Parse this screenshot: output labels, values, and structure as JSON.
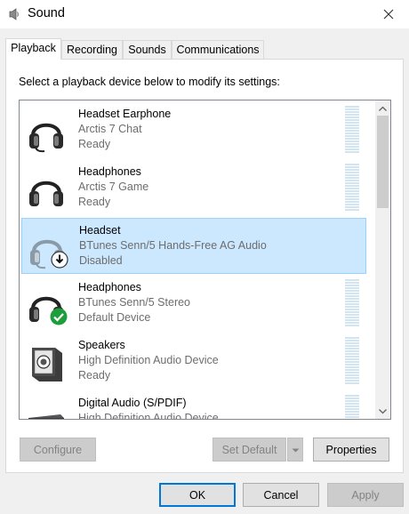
{
  "window": {
    "title": "Sound",
    "icon": "speaker-icon",
    "close_icon": "close-icon"
  },
  "tabs": [
    {
      "label": "Playback",
      "active": true
    },
    {
      "label": "Recording",
      "active": false
    },
    {
      "label": "Sounds",
      "active": false
    },
    {
      "label": "Communications",
      "active": false
    }
  ],
  "instruction": "Select a playback device below to modify its settings:",
  "devices": [
    {
      "name": "Headset Earphone",
      "description": "Arctis 7 Chat",
      "status": "Ready",
      "icon": "headset-mic-icon",
      "badge": null,
      "selected": false
    },
    {
      "name": "Headphones",
      "description": "Arctis 7 Game",
      "status": "Ready",
      "icon": "headphones-icon",
      "badge": null,
      "selected": false
    },
    {
      "name": "Headset",
      "description": "BTunes Senn/5 Hands-Free AG Audio",
      "status": "Disabled",
      "icon": "headset-icon",
      "badge": "disabled-down-arrow-icon",
      "selected": true
    },
    {
      "name": "Headphones",
      "description": "BTunes Senn/5 Stereo",
      "status": "Default Device",
      "icon": "headphones-icon",
      "badge": "default-checkmark-icon",
      "selected": false
    },
    {
      "name": "Speakers",
      "description": "High Definition Audio Device",
      "status": "Ready",
      "icon": "speaker-box-icon",
      "badge": null,
      "selected": false
    },
    {
      "name": "Digital Audio (S/PDIF)",
      "description": "High Definition Audio Device",
      "status": "",
      "icon": "digital-audio-icon",
      "badge": null,
      "selected": false
    }
  ],
  "buttons": {
    "configure": "Configure",
    "set_default": "Set Default",
    "properties": "Properties",
    "ok": "OK",
    "cancel": "Cancel",
    "apply": "Apply"
  },
  "colors": {
    "selection_bg": "#cce8ff",
    "selection_border": "#99d1ff",
    "default_badge": "#1e9e3a",
    "focus_border": "#0078d7"
  }
}
